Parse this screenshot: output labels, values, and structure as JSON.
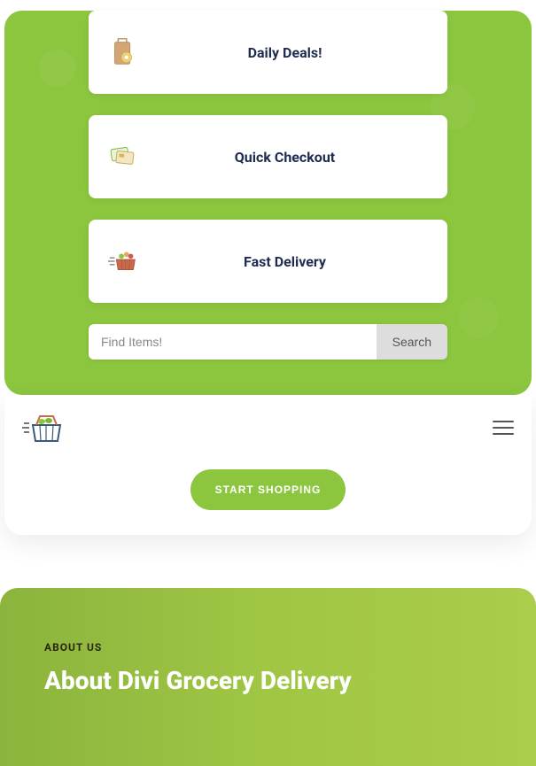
{
  "features": [
    {
      "label": "Daily Deals!",
      "icon": "shopping-bag-icon"
    },
    {
      "label": "Quick Checkout",
      "icon": "payment-cards-icon"
    },
    {
      "label": "Fast Delivery",
      "icon": "basket-delivery-icon"
    }
  ],
  "search": {
    "placeholder": "Find Items!",
    "buttonLabel": "Search"
  },
  "cta": {
    "label": "START SHOPPING"
  },
  "about": {
    "eyebrow": "ABOUT US",
    "title": "About Divi Grocery Delivery"
  },
  "colors": {
    "accent": "#8cc63f",
    "navy": "#1f2b50"
  }
}
